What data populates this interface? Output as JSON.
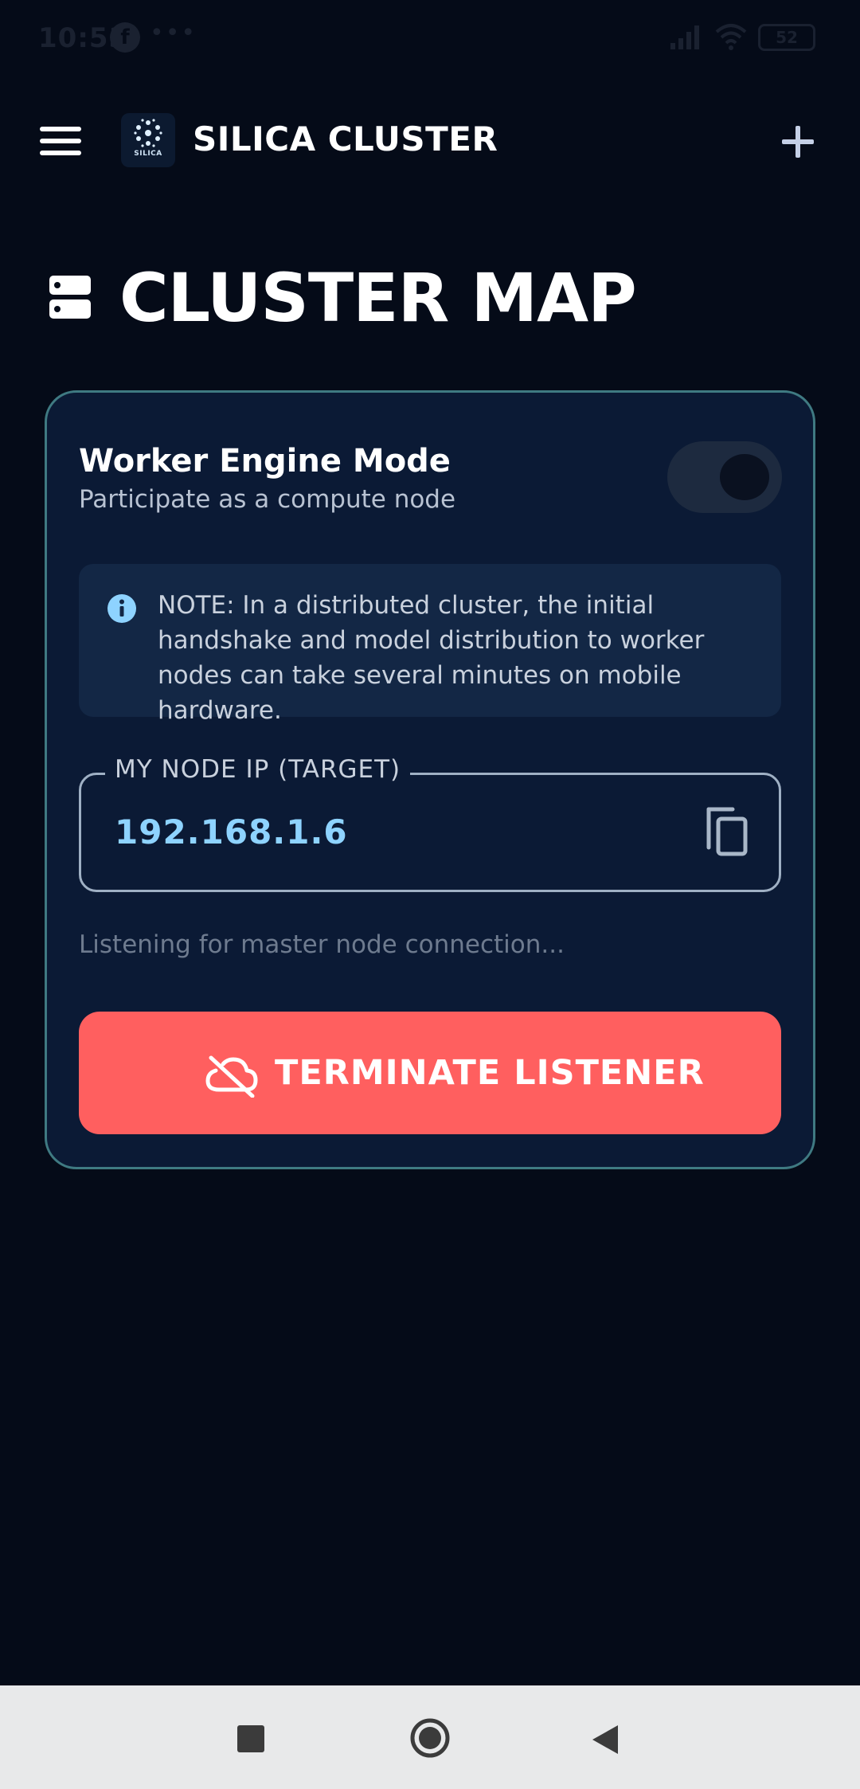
{
  "status_bar": {
    "time": "10:53",
    "fb_glyph": "f",
    "dots": "•••",
    "battery": "52"
  },
  "app_bar": {
    "title": "SILICA CLUSTER",
    "logo_text": "SILICA",
    "menu_icon": "hamburger-menu-icon",
    "add_icon": "plus-icon"
  },
  "page": {
    "title": "CLUSTER MAP",
    "title_icon": "server-icon"
  },
  "worker": {
    "title": "Worker Engine Mode",
    "subtitle": "Participate as a compute node",
    "enabled": true
  },
  "note": {
    "text": "NOTE: In a distributed cluster, the initial handshake and model distribution to worker nodes can take several minutes on mobile hardware."
  },
  "node_ip": {
    "label": "MY NODE IP (TARGET)",
    "value": "192.168.1.6"
  },
  "status_text": "Listening for master node connection...",
  "terminate_button": {
    "label": "TERMINATE LISTENER",
    "icon": "cloud-off-icon"
  },
  "colors": {
    "background": "#050b18",
    "card": "#0b1a35",
    "card_border": "#3f7a82",
    "accent": "#8ed3ff",
    "danger": "#ff5f5f"
  }
}
